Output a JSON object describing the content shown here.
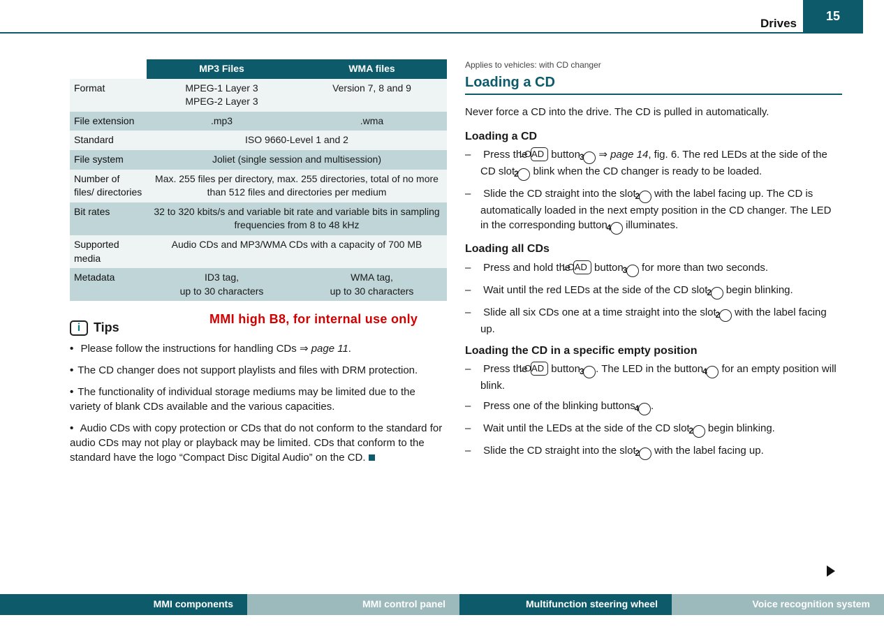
{
  "header": {
    "section": "Drives",
    "page_number": "15"
  },
  "table": {
    "head": {
      "c1": "MP3 Files",
      "c2": "WMA files"
    },
    "rows": {
      "format": {
        "label": "Format",
        "c1": "MPEG-1 Layer 3\nMPEG-2 Layer 3",
        "c2": "Version 7, 8 and 9"
      },
      "ext": {
        "label": "File extension",
        "c1": ".mp3",
        "c2": ".wma"
      },
      "standard": {
        "label": "Standard",
        "span": "ISO 9660-Level 1 and 2"
      },
      "fs": {
        "label": "File system",
        "span": "Joliet (single session and multisession)"
      },
      "files": {
        "label": "Number of files/ directories",
        "span": "Max. 255 files per directory, max. 255 directories, total of no more than 512 files and directories per medium"
      },
      "bitrate": {
        "label": "Bit rates",
        "span": "32 to 320 kbits/s and variable bit rate and variable bits in sampling frequencies from 8 to 48 kHz"
      },
      "media": {
        "label": "Supported media",
        "span": "Audio CDs and MP3/WMA CDs with a capacity of 700 MB"
      },
      "meta": {
        "label": "Metadata",
        "c1": "ID3 tag,\nup to 30 characters",
        "c2": "WMA tag,\nup to 30 characters"
      }
    }
  },
  "tips": {
    "title": "Tips",
    "items": {
      "t1a": "Please follow the instructions for handling CDs ",
      "t1b": "page 11",
      "t2": "The CD changer does not support playlists and files with DRM protection.",
      "t3": "The functionality of individual storage mediums may be limited due to the variety of blank CDs available and the various capacities.",
      "t4": "Audio CDs with copy protection or CDs that do not conform to the standard for audio CDs may not play or playback may be limited. CDs that conform to the standard have the logo “Compact Disc Digital Audio” on the CD."
    }
  },
  "right": {
    "applies": "Applies to vehicles: with CD changer",
    "title": "Loading a CD",
    "lead": "Never force a CD into the drive. The CD is pulled in automatically.",
    "sub1": "Loading a CD",
    "s1": {
      "a1": "Press the ",
      "btn1": "LOAD",
      "a2": " button ",
      "n1": "3",
      "a3": " ",
      "ref": "page 14",
      "a4": ", fig. 6. The red LEDs at the side of the CD slot ",
      "n2": "2",
      "a5": " blink when the CD changer is ready to be loaded.",
      "b1": "Slide the CD straight into the slot ",
      "n3": "2",
      "b2": " with the label facing up. The CD is automatically loaded in the next empty position in the CD changer. The LED in the corresponding button ",
      "n4": "4",
      "b3": " illuminates."
    },
    "sub2": "Loading all CDs",
    "s2": {
      "a1": "Press and hold the ",
      "btn1": "LOAD",
      "a2": " button ",
      "n1": "3",
      "a3": " for more than two seconds.",
      "b1": "Wait until the red LEDs at the side of the CD slot ",
      "n2": "2",
      "b2": " begin blinking.",
      "c1": "Slide all six CDs one at a time straight into the slot ",
      "n3": "2",
      "c2": " with the label facing up."
    },
    "sub3": "Loading the CD in a specific empty position",
    "s3": {
      "a1": "Press the ",
      "btn1": "LOAD",
      "a2": " button ",
      "n1": "3",
      "a3": ". The LED in the button ",
      "n2": "4",
      "a4": " for an empty position will blink.",
      "b1": "Press one of the blinking buttons ",
      "n3": "4",
      "b2": ".",
      "c1": "Wait until the LEDs at the side of the CD slot ",
      "n4": "2",
      "c2": " begin blinking.",
      "d1": "Slide the CD straight into the slot ",
      "n5": "2",
      "d2": " with the label facing up."
    }
  },
  "watermark": "MMI high B8, for internal use only",
  "footer": {
    "t1": "MMI components",
    "t2": "MMI control panel",
    "t3": "Multifunction steering wheel",
    "t4": "Voice recognition system"
  }
}
